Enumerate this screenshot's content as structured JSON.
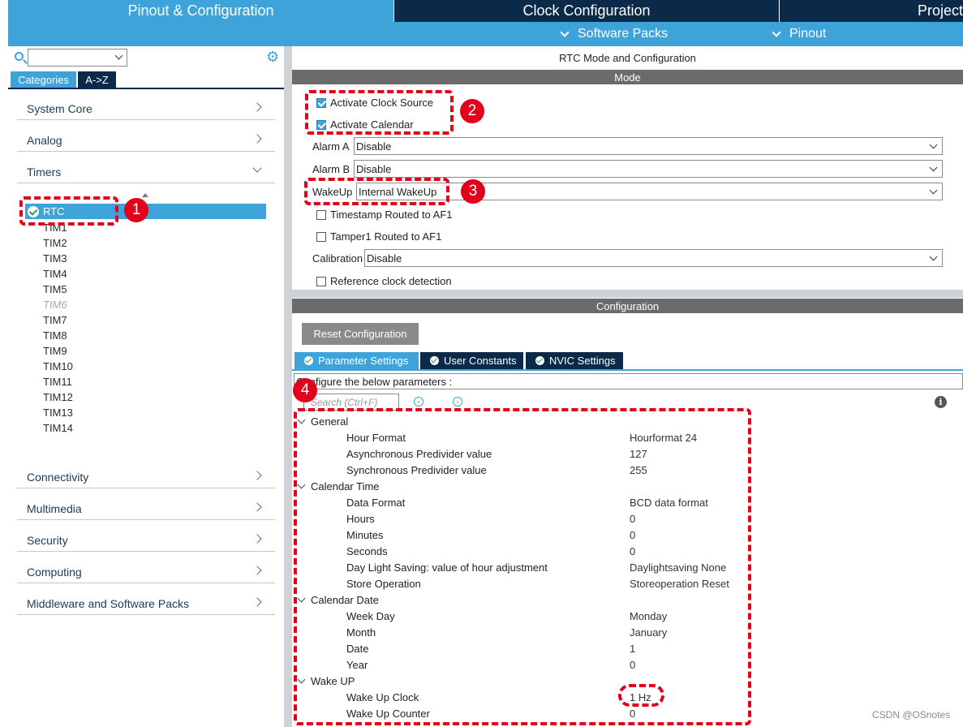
{
  "top_tabs": {
    "pinout": "Pinout & Configuration",
    "clock": "Clock Configuration",
    "project": "Project"
  },
  "subbar": {
    "software_packs": "Software Packs",
    "pinout": "Pinout"
  },
  "left": {
    "tabs": [
      "Categories",
      "A->Z"
    ],
    "categories_top": [
      "System Core",
      "Analog",
      "Timers"
    ],
    "timers": {
      "selected": "RTC",
      "items": [
        "TIM1",
        "TIM2",
        "TIM3",
        "TIM4",
        "TIM5",
        "TIM6",
        "TIM7",
        "TIM8",
        "TIM9",
        "TIM10",
        "TIM11",
        "TIM12",
        "TIM13",
        "TIM14"
      ],
      "disabled": [
        "TIM6"
      ]
    },
    "categories_bottom": [
      "Connectivity",
      "Multimedia",
      "Security",
      "Computing",
      "Middleware and Software Packs"
    ]
  },
  "right": {
    "title": "RTC Mode and Configuration",
    "mode_header": "Mode",
    "mode": {
      "activate_clock_source": "Activate Clock Source",
      "activate_calendar": "Activate Calendar",
      "alarm_a_label": "Alarm A",
      "alarm_a_value": "Disable",
      "alarm_b_label": "Alarm B",
      "alarm_b_value": "Disable",
      "wakeup_label": "WakeUp",
      "wakeup_value": "Internal WakeUp",
      "timestamp": "Timestamp Routed to AF1",
      "tamper": "Tamper1 Routed to AF1",
      "calibration_label": "Calibration",
      "calibration_value": "Disable",
      "ref_clock": "Reference clock detection"
    },
    "config_header": "Configuration",
    "reset_button": "Reset Configuration",
    "param_tabs": [
      "Parameter Settings",
      "User Constants",
      "NVIC Settings"
    ],
    "configure_text": "Configure the below parameters :",
    "search_placeholder": "Search (Ctrl+F)",
    "groups": [
      {
        "name": "General",
        "params": [
          {
            "name": "Hour Format",
            "value": "Hourformat 24"
          },
          {
            "name": "Asynchronous Predivider value",
            "value": "127"
          },
          {
            "name": "Synchronous Predivider value",
            "value": "255"
          }
        ]
      },
      {
        "name": "Calendar Time",
        "params": [
          {
            "name": "Data Format",
            "value": "BCD data format"
          },
          {
            "name": "Hours",
            "value": "0"
          },
          {
            "name": "Minutes",
            "value": "0"
          },
          {
            "name": "Seconds",
            "value": "0"
          },
          {
            "name": "Day Light Saving: value of hour adjustment",
            "value": "Daylightsaving None"
          },
          {
            "name": "Store Operation",
            "value": "Storeoperation Reset"
          }
        ]
      },
      {
        "name": "Calendar Date",
        "params": [
          {
            "name": "Week Day",
            "value": "Monday"
          },
          {
            "name": "Month",
            "value": "January"
          },
          {
            "name": "Date",
            "value": "1"
          },
          {
            "name": "Year",
            "value": "0"
          }
        ]
      },
      {
        "name": "Wake UP",
        "params": [
          {
            "name": "Wake Up Clock",
            "value": "1 Hz"
          },
          {
            "name": "Wake Up Counter",
            "value": "0"
          }
        ]
      }
    ]
  },
  "annotations": {
    "badges": [
      "1",
      "2",
      "3",
      "4"
    ]
  },
  "watermark": "CSDN @OSnotes",
  "colors": {
    "accent": "#3ea3d9",
    "dark": "#0b2a4a",
    "annotation_red": "#e3001b"
  }
}
